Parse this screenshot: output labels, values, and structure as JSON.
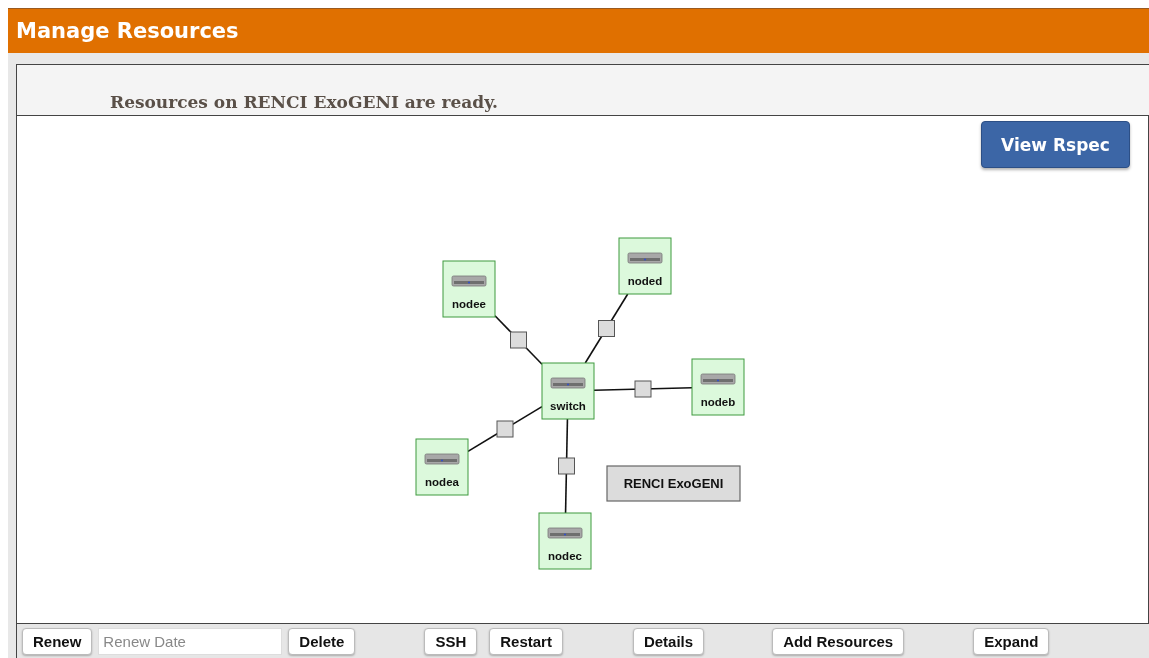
{
  "header": {
    "title": "Manage Resources"
  },
  "status": {
    "message": "Resources on RENCI ExoGENI are ready."
  },
  "topology": {
    "view_button": "View Rspec",
    "site_label": "RENCI ExoGENI",
    "nodes": [
      {
        "label": "switch"
      },
      {
        "label": "nodea"
      },
      {
        "label": "nodeb"
      },
      {
        "label": "nodec"
      },
      {
        "label": "noded"
      },
      {
        "label": "nodee"
      }
    ]
  },
  "toolbar": [
    {
      "kind": "button",
      "label": "Renew"
    },
    {
      "kind": "field",
      "placeholder": "Renew Date"
    },
    {
      "kind": "button",
      "label": "Delete"
    },
    {
      "kind": "button",
      "label": "SSH"
    },
    {
      "kind": "button",
      "label": "Restart"
    },
    {
      "kind": "button",
      "label": "Details"
    },
    {
      "kind": "button",
      "label": "Add Resources"
    },
    {
      "kind": "button",
      "label": "Expand"
    }
  ]
}
